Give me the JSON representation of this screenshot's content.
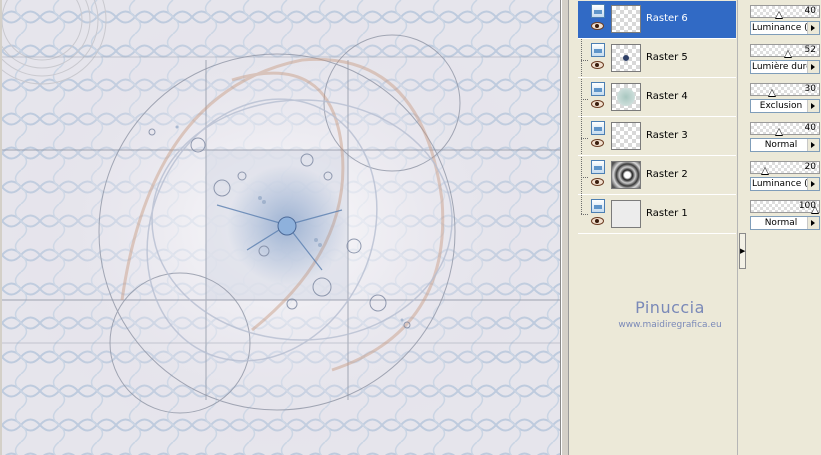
{
  "layers": [
    {
      "name": "Raster 6",
      "selected": true,
      "thumb": "transparent"
    },
    {
      "name": "Raster 5",
      "selected": false,
      "thumb": "dark-spot"
    },
    {
      "name": "Raster 4",
      "selected": false,
      "thumb": "flower-pattern"
    },
    {
      "name": "Raster 3",
      "selected": false,
      "thumb": "transparent"
    },
    {
      "name": "Raster 2",
      "selected": false,
      "thumb": "spiral-gradient"
    },
    {
      "name": "Raster 1",
      "selected": false,
      "thumb": "light-gray"
    }
  ],
  "properties": [
    {
      "opacity": "40",
      "blend": "Luminance (H)"
    },
    {
      "opacity": "52",
      "blend": "Lumière dure"
    },
    {
      "opacity": "30",
      "blend": "Exclusion"
    },
    {
      "opacity": "40",
      "blend": "Normal"
    },
    {
      "opacity": "20",
      "blend": "Luminance (H)"
    },
    {
      "opacity": "100",
      "blend": "Normal"
    }
  ],
  "watermark": {
    "name": "Pinuccia",
    "url": "www.maidiregrafica.eu"
  },
  "icons": {
    "layer": "raster-layer-icon",
    "visibility": "eye-icon",
    "expand": "chevron-right-icon",
    "dropdown": "dropdown-arrow-icon"
  },
  "colors": {
    "selection": "#316ac5",
    "panel": "#ece9d8",
    "watermark": "#7a89b8",
    "accent_blue": "#5a7fb0",
    "accent_peach": "#c89a80"
  }
}
